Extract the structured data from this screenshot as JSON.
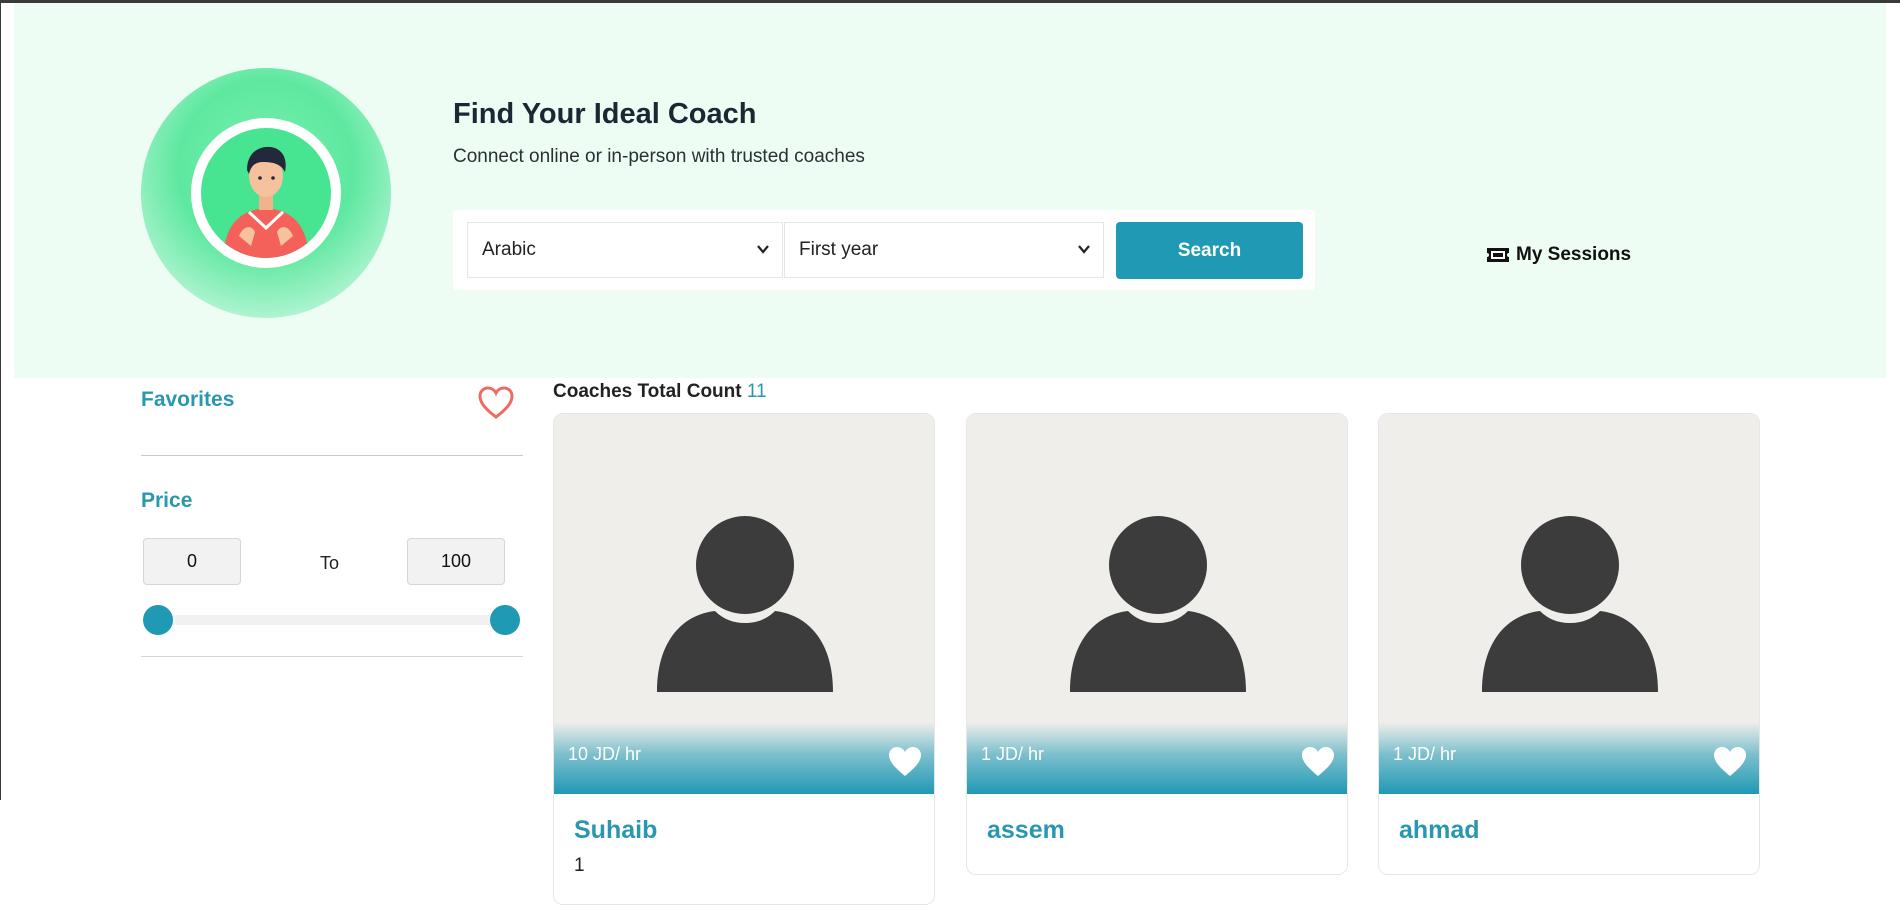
{
  "hero": {
    "title": "Find Your Ideal Coach",
    "subtitle": "Connect online or in-person with trusted coaches",
    "language_select": "Arabic",
    "year_select": "First year",
    "search_label": "Search",
    "sessions_label": "My Sessions"
  },
  "filters": {
    "favorites_label": "Favorites",
    "price_label": "Price",
    "price_min": "0",
    "price_to": "To",
    "price_max": "100",
    "slider_min_value": 0,
    "slider_max_value": 100
  },
  "results": {
    "count_label": "Coaches Total Count",
    "count_value": "11"
  },
  "coaches": [
    {
      "name": "Suhaib",
      "price": "10 JD/ hr",
      "extra": "1"
    },
    {
      "name": "assem",
      "price": "1 JD/ hr",
      "extra": ""
    },
    {
      "name": "ahmad",
      "price": "1 JD/ hr",
      "extra": ""
    }
  ],
  "colors": {
    "accent": "#1f99b4",
    "hero_bg": "#edfdf4",
    "favorite_heart": "#f06a62"
  }
}
